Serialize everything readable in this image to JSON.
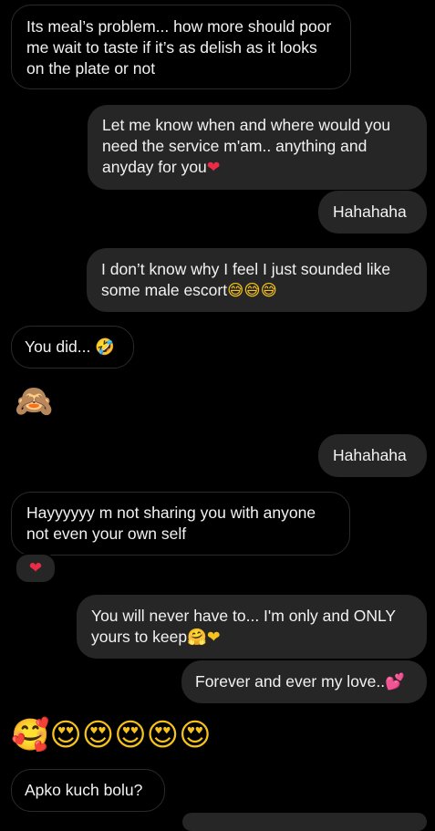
{
  "messages": [
    {
      "text": "Its meal’s problem... how more should poor me wait to taste if it’s as delish as it looks on the plate or not"
    },
    {
      "text": "Let me know when and where would you need the service m'am.. anything and anyday for you",
      "emoji": "❤"
    },
    {
      "text": "Hahahaha"
    },
    {
      "text": "I don’t know why I feel I just sounded like some male escort",
      "emoji": "😅😅😅"
    },
    {
      "text": "You did...",
      "emoji": "🤣"
    },
    {
      "emoji": "🙈"
    },
    {
      "text": "Hahahaha"
    },
    {
      "text": "Hayyyyyy m not sharing you with anyone not even your own self",
      "reaction": "❤"
    },
    {
      "text": "You will never have to... I'm only and ONLY yours to keep",
      "emoji": "🤗❤"
    },
    {
      "text": "Forever and ever my love..",
      "emoji": "💕"
    },
    {
      "emoji": "🥰😍😍😍😍😍"
    },
    {
      "text": "Apko kuch bolu?"
    }
  ]
}
